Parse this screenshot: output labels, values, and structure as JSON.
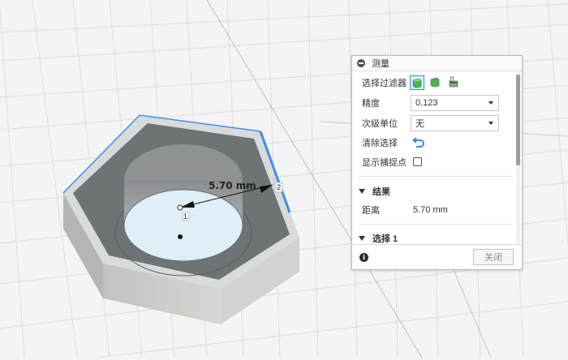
{
  "viewport": {
    "dimension_label": "5.70 mm",
    "point_1_label": "1",
    "point_2_label": "2",
    "colors": {
      "grid": "#dcdde0",
      "model_top": "#6e7376",
      "model_side": "#c9c9c7",
      "highlight": "#3f8fe6",
      "axis_green": "#8fcf8f",
      "axis_red": "#e79a9a"
    }
  },
  "panel": {
    "title": "测量",
    "selection_filter": {
      "label": "选择过滤器",
      "icons": [
        "body-filter-icon",
        "face-filter-icon",
        "edge-filter-icon"
      ]
    },
    "precision": {
      "label": "精度",
      "value": "0.123"
    },
    "secondary_unit": {
      "label": "次级单位",
      "value": "无"
    },
    "clear_selection": {
      "label": "清除选择",
      "icon": "undo-arrow-icon"
    },
    "show_snap_points": {
      "label": "显示捕捉点",
      "checked": false
    },
    "results": {
      "title": "结果",
      "distance_label": "距离",
      "distance_value": "5.70 mm"
    },
    "selection1": {
      "title": "选择 1"
    },
    "close_label": "关闭",
    "accent_color": "#2f8fe8"
  }
}
